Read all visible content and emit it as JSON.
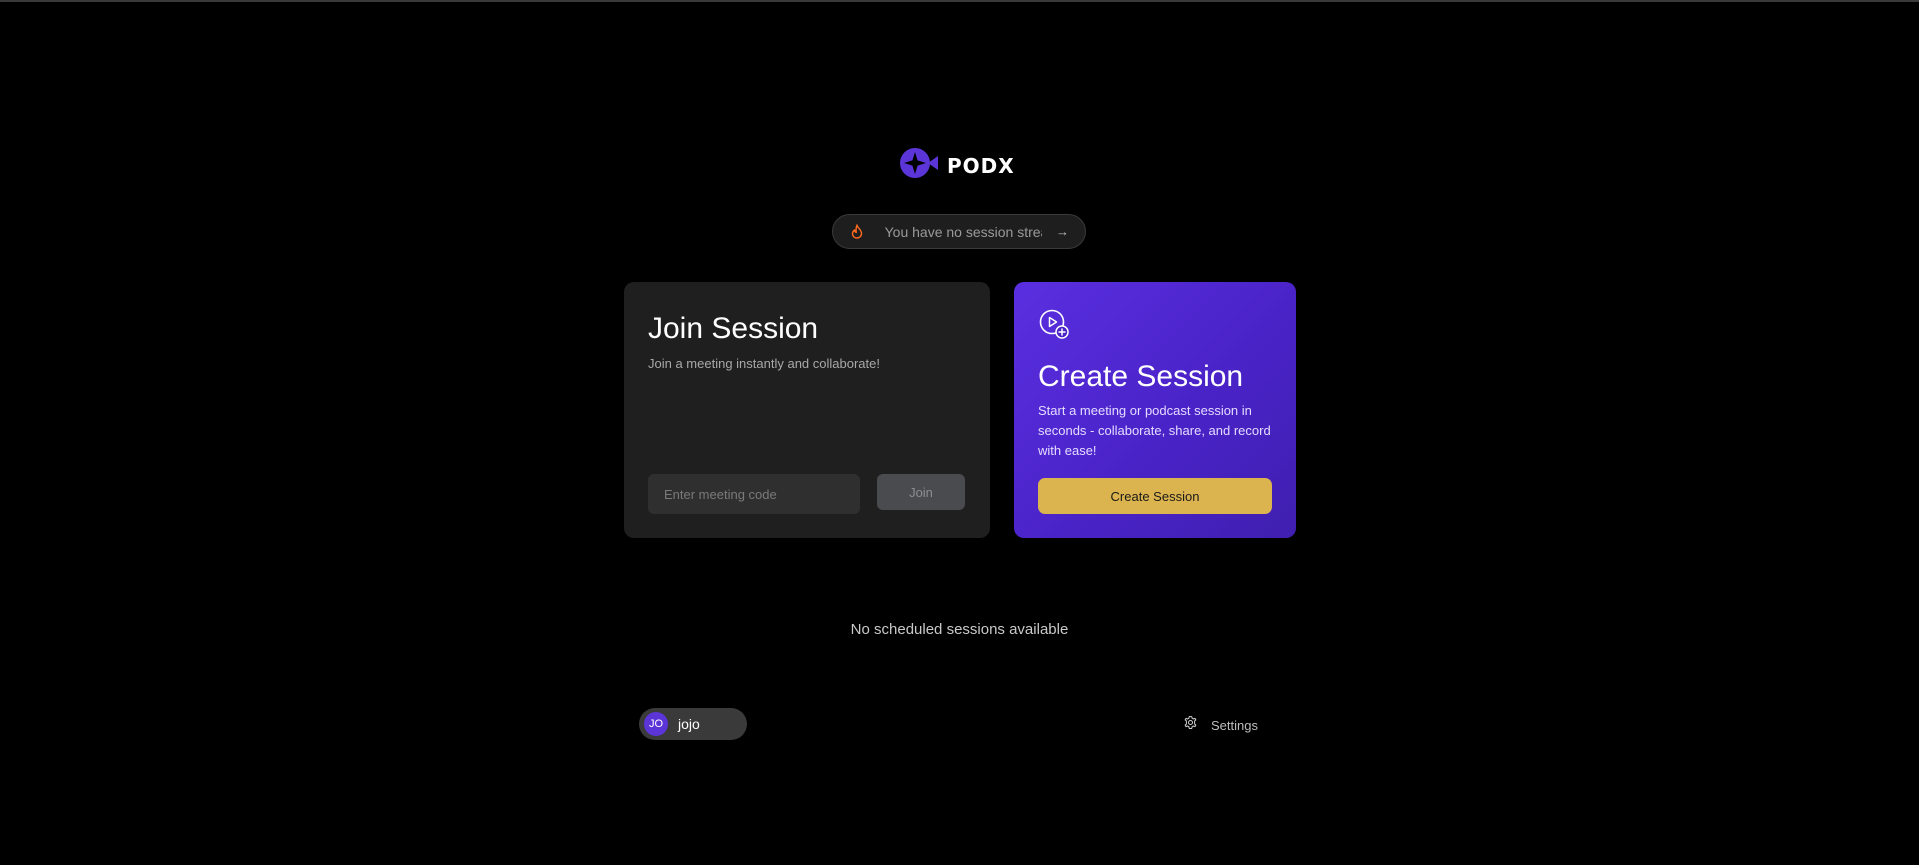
{
  "brand": {
    "name": "PODX",
    "accent_color": "#5b35d8"
  },
  "streak": {
    "text": "You have no session streak",
    "arrow": "→",
    "icon": "flame-icon"
  },
  "join_card": {
    "title": "Join Session",
    "subtitle": "Join a meeting instantly and collaborate!",
    "input_placeholder": "Enter meeting code",
    "input_value": "",
    "button_label": "Join"
  },
  "create_card": {
    "icon": "play-plus-icon",
    "title": "Create Session",
    "description": "Start a meeting or podcast session in seconds - collaborate, share, and record with ease!",
    "button_label": "Create Session",
    "button_color": "#dcb44f"
  },
  "scheduled": {
    "empty_text": "No scheduled sessions available"
  },
  "user": {
    "initials": "JO",
    "name": "jojo"
  },
  "settings": {
    "label": "Settings",
    "icon": "gear-icon"
  }
}
